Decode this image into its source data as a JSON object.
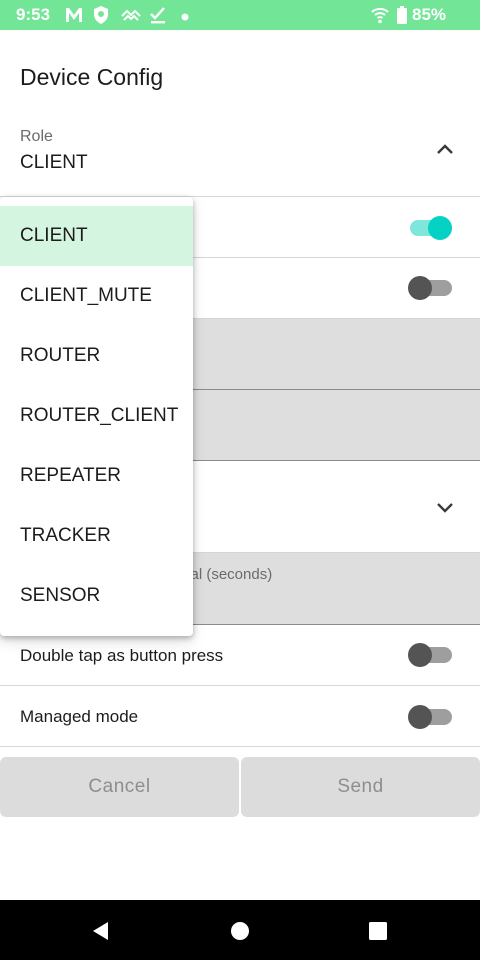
{
  "status_bar": {
    "time": "9:53",
    "battery_percent": "85%",
    "icons": [
      "gmail-icon",
      "vpn-shield-icon",
      "signal-wave-icon",
      "download-done-icon",
      "dot-icon",
      "wifi-icon",
      "battery-icon"
    ],
    "background_color": "#73e597"
  },
  "screen": {
    "title": "Device Config"
  },
  "role_field": {
    "label": "Role",
    "value": "CLIENT",
    "expanded": true
  },
  "dropdown": {
    "options": [
      "CLIENT",
      "CLIENT_MUTE",
      "ROUTER",
      "ROUTER_CLIENT",
      "REPEATER",
      "TRACKER",
      "SENSOR"
    ],
    "selected_index": 0,
    "selected_color": "#d4f6e0"
  },
  "settings": {
    "toggle_1": {
      "state": true
    },
    "toggle_2": {
      "state": false
    },
    "interval_field": {
      "visible_hint": "rval (seconds)"
    },
    "double_tap": {
      "label": "Double tap as button press",
      "state": false
    },
    "managed_mode": {
      "label": "Managed mode",
      "state": false
    }
  },
  "buttons": {
    "cancel": "Cancel",
    "send": "Send"
  },
  "colors": {
    "accent": "#05d2c4",
    "switch_off_thumb": "#545454",
    "field_fill": "#dedede"
  },
  "nav_bar": {
    "icons": [
      "back-icon",
      "home-icon",
      "recents-icon"
    ]
  }
}
